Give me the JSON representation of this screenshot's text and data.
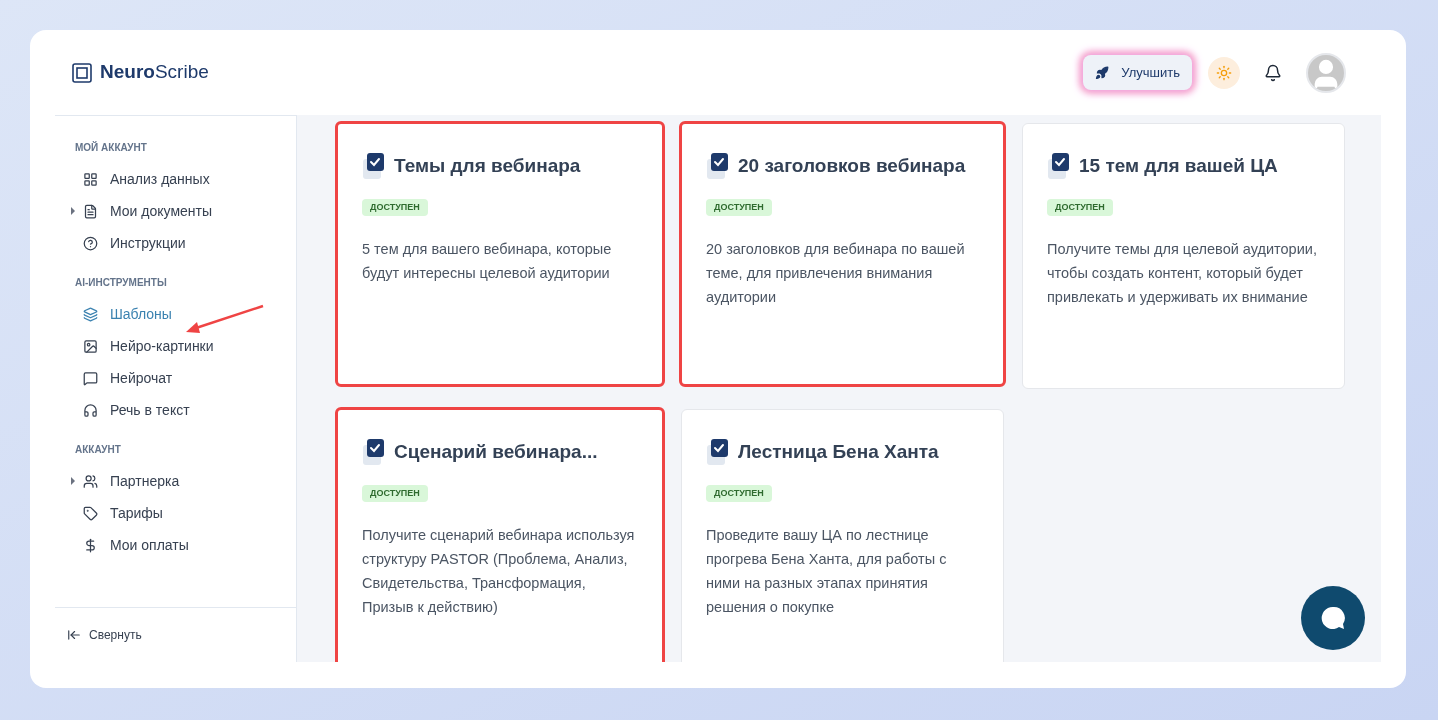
{
  "brand": {
    "bold": "Neuro",
    "light": "Scribe"
  },
  "header": {
    "upgrade_button": "Улучшить"
  },
  "sidebar": {
    "sections": [
      {
        "title": "МОЙ АККАУНТ",
        "items": [
          {
            "label": "Анализ данных",
            "kind": "grid",
            "expandable": false,
            "selected": false
          },
          {
            "label": "Мои документы",
            "kind": "file",
            "expandable": true,
            "selected": false
          },
          {
            "label": "Инструкции",
            "kind": "help",
            "expandable": false,
            "selected": false
          }
        ]
      },
      {
        "title": "AI-ИНСТРУМЕНТЫ",
        "items": [
          {
            "label": "Шаблоны",
            "kind": "layers",
            "expandable": false,
            "selected": true
          },
          {
            "label": "Нейро-картинки",
            "kind": "image",
            "expandable": false,
            "selected": false
          },
          {
            "label": "Нейрочат",
            "kind": "chat",
            "expandable": false,
            "selected": false
          },
          {
            "label": "Речь в текст",
            "kind": "headphones",
            "expandable": false,
            "selected": false
          }
        ]
      },
      {
        "title": "АККАУНТ",
        "items": [
          {
            "label": "Партнерка",
            "kind": "users",
            "expandable": true,
            "selected": false
          },
          {
            "label": "Тарифы",
            "kind": "tag",
            "expandable": false,
            "selected": false
          },
          {
            "label": "Мои оплаты",
            "kind": "dollar",
            "expandable": false,
            "selected": false
          }
        ]
      }
    ],
    "collapse": "Свернуть"
  },
  "cards": [
    {
      "title": "Темы для вебинара",
      "badge": "ДОСТУПЕН",
      "description": "5 тем для вашего вебинара, которые будут интересны целевой аудитории",
      "highlighted": true
    },
    {
      "title": "20 заголовков вебинара",
      "badge": "ДОСТУПЕН",
      "description": "20 заголовков для вебинара по вашей теме, для привлечения внимания аудитории",
      "highlighted": true
    },
    {
      "title": "15 тем для вашей ЦА",
      "badge": "ДОСТУПЕН",
      "description": "Получите темы для целевой аудитории, чтобы создать контент, который будет привлекать и удерживать их внимание",
      "highlighted": false
    },
    {
      "title": "Сценарий вебинара...",
      "badge": "ДОСТУПЕН",
      "description": "Получите сценарий вебинара используя структуру PASTOR (Проблема, Анализ, Свидетельства, Трансформация, Призыв к действию)",
      "highlighted": true
    },
    {
      "title": "Лестница Бена Ханта",
      "badge": "ДОСТУПЕН",
      "description": "Проведите вашу ЦА по лестнице прогрева Бена Ханта, для работы с ними на разных этапах принятия решения о покупке",
      "highlighted": false
    }
  ]
}
